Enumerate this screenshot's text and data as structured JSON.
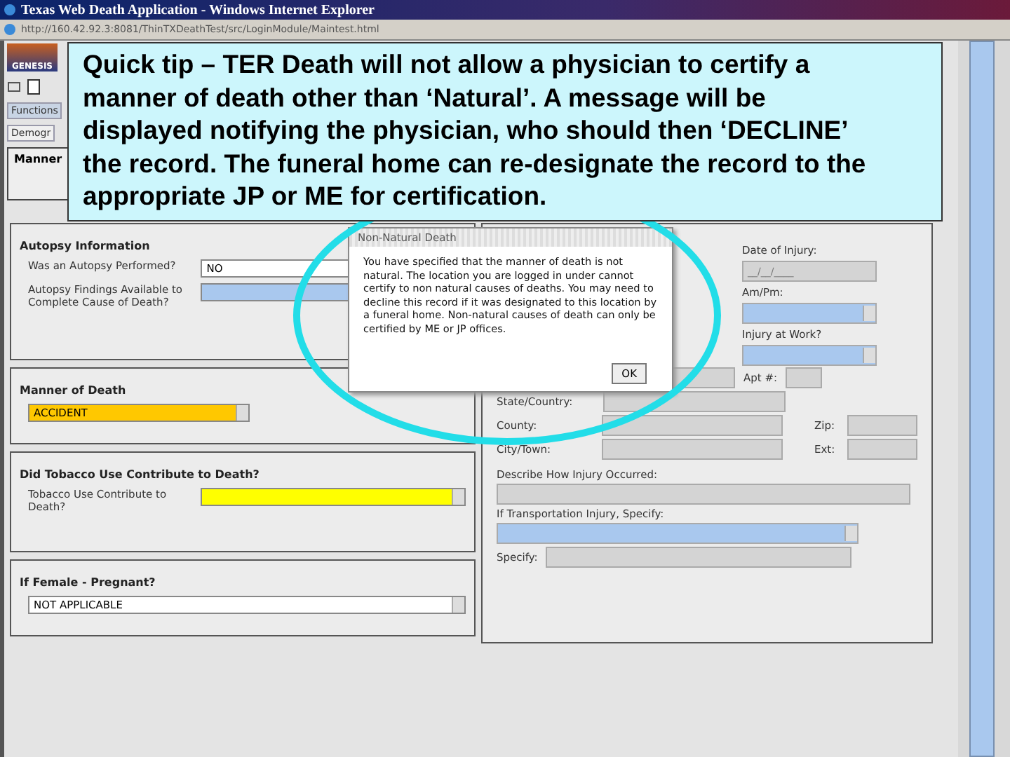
{
  "window": {
    "title": "Texas Web Death Application - Windows Internet Explorer"
  },
  "address_bar": {
    "url": "http://160.42.92.3:8081/ThinTXDeathTest/src/LoginModule/Maintest.html"
  },
  "app": {
    "logo": "GENESIS",
    "tabs": [
      {
        "label": "Functions",
        "selected": false
      },
      {
        "label": "Demogr",
        "selected": true
      }
    ],
    "panel_title": "Manner"
  },
  "left_sections": [
    {
      "title": "Autopsy Information",
      "fields": [
        {
          "label": "Was an Autopsy Performed?",
          "kind": "text",
          "value": "NO",
          "color": "#ffffff"
        },
        {
          "label": "Autopsy Findings Available to Complete Cause of Death?",
          "kind": "text",
          "color": "#a9c8ee"
        }
      ]
    },
    {
      "title": "Manner of Death",
      "fields": [
        {
          "kind": "select",
          "value": "ACCIDENT",
          "color": "#ffc800"
        }
      ]
    },
    {
      "title": "Did Tobacco Use Contribute to Death?",
      "fields": [
        {
          "label": "Tobacco Use Contribute to Death?",
          "kind": "select",
          "color": "#ffff00"
        }
      ]
    },
    {
      "title": "If Female - Pregnant?",
      "fields": [
        {
          "kind": "select",
          "value": "NOT APPLICABLE",
          "color": "#ffffff"
        }
      ]
    }
  ],
  "injury_panel": {
    "date_label": "Date of Injury:",
    "date_placeholder": "__/__/____",
    "ampm_label": "Am/Pm:",
    "work_label": "Injury at Work?",
    "apt_label": "Apt #:",
    "state_label": "State/Country:",
    "county_label": "County:",
    "city_label": "City/Town:",
    "zip_label": "Zip:",
    "ext_label": "Ext:",
    "describe_label": "Describe How Injury Occurred:",
    "transport_label": "If Transportation Injury, Specify:",
    "specify_label": "Specify:"
  },
  "dialog": {
    "title": "Non-Natural Death",
    "message": "You have specified that the manner of death is not natural.  The location you are logged in under cannot certify to non natural causes of deaths. You may need to decline this record if it was designated to this location by a funeral home. Non-natural causes of death can only be certified by ME or JP offices.",
    "button": "OK"
  },
  "callout": {
    "text": "Quick tip – TER Death will not allow a physician to certify a manner of death other than ‘Natural’.  A message will be displayed notifying the physician, who should then ‘DECLINE’ the record.  The funeral home can re-designate the record to the appropriate JP or ME for certification."
  }
}
